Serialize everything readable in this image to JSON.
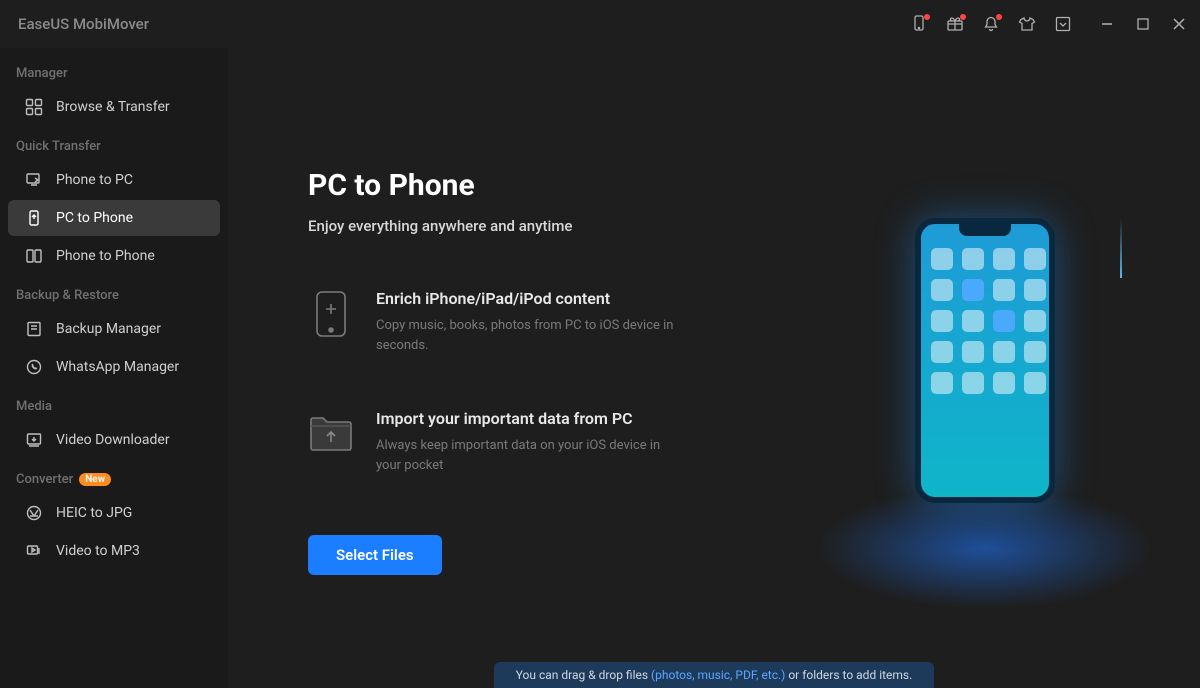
{
  "app_title": "EaseUS MobiMover",
  "sidebar": {
    "sections": [
      {
        "label": "Manager",
        "items": [
          {
            "label": "Browse & Transfer",
            "icon": "grid-icon"
          }
        ]
      },
      {
        "label": "Quick Transfer",
        "items": [
          {
            "label": "Phone to PC",
            "icon": "phone-to-pc-icon"
          },
          {
            "label": "PC to Phone",
            "icon": "pc-to-phone-icon",
            "active": true
          },
          {
            "label": "Phone to Phone",
            "icon": "phone-to-phone-icon"
          }
        ]
      },
      {
        "label": "Backup & Restore",
        "items": [
          {
            "label": "Backup Manager",
            "icon": "backup-icon"
          },
          {
            "label": "WhatsApp Manager",
            "icon": "whatsapp-icon"
          }
        ]
      },
      {
        "label": "Media",
        "items": [
          {
            "label": "Video Downloader",
            "icon": "video-download-icon"
          }
        ]
      },
      {
        "label": "Converter",
        "badge": "New",
        "items": [
          {
            "label": "HEIC to JPG",
            "icon": "heic-icon"
          },
          {
            "label": "Video to MP3",
            "icon": "video-mp3-icon"
          }
        ]
      }
    ]
  },
  "main": {
    "title": "PC to Phone",
    "subtitle": "Enjoy everything anywhere and anytime",
    "features": [
      {
        "title": "Enrich iPhone/iPad/iPod content",
        "desc": "Copy music, books, photos from PC to iOS device in seconds."
      },
      {
        "title": "Import your important data from PC",
        "desc": "Always keep important data on your iOS device in your pocket"
      }
    ],
    "select_button": "Select Files",
    "hint_pre": "You can drag & drop files ",
    "hint_hl": "(photos, music, PDF, etc.)",
    "hint_post": " or folders to add items."
  }
}
